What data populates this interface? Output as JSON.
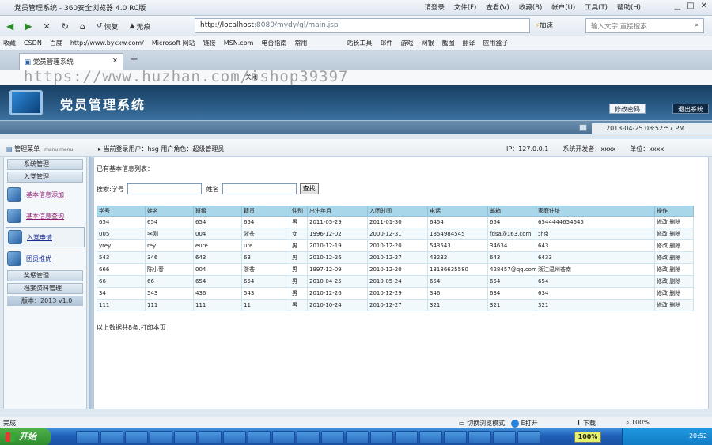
{
  "browser": {
    "window_title": "党员管理系统 - 360安全浏览器 4.0 RC版",
    "menus": [
      "请登录",
      "文件(F)",
      "查看(V)",
      "收藏(B)",
      "帐户(U)",
      "工具(T)",
      "帮助(H)"
    ],
    "nav": {
      "back": "后退",
      "forward": "前进",
      "restore": "恢复",
      "no_trace": "无痕"
    },
    "address_host": "http://localhost",
    "address_rest": ":8080/mydy/gl/main.jsp",
    "accelerate": "加速",
    "search_placeholder": "输入文字,直接搜索",
    "favorites": [
      "收藏",
      "CSDN",
      "百度",
      "http://www.bycxw.com/",
      "Microsoft 网站",
      "链接",
      "MSN.com",
      "电台指南",
      "常用",
      "站长工具",
      "邮件",
      "游戏",
      "网银",
      "截图",
      "翻译",
      "应用盒子"
    ],
    "tab_label": "党员管理系统",
    "tab_add": "+",
    "sub_text": "关闭",
    "watermark": "https://www.huzhan.com/ishop39397"
  },
  "app": {
    "title": "党员管理系统",
    "change_password": "修改密码",
    "logout": "退出系统",
    "datetime": "2013-04-25 08:52:57 PM"
  },
  "infobar": {
    "menu_title": "管理菜单",
    "menu_subtitle": "manu menu",
    "current_user": "当前登录用户：hsg  用户角色：超级管理员",
    "ip": "IP：127.0.0.1",
    "developer": "系统开发者：xxxx",
    "unit": "单位：xxxx"
  },
  "sidebar": {
    "sections": [
      "系统管理",
      "入党管理"
    ],
    "items": [
      "基本信息添加",
      "基本信息查询",
      "入党申请",
      "团员推优"
    ],
    "sections2": [
      "奖惩管理",
      "档案资料管理"
    ],
    "version": "版本：2013 v1.0"
  },
  "main": {
    "list_title": "已有基本信息列表：",
    "search_label_id": "搜索:学号",
    "search_label_name": "姓名",
    "search_button": "查找",
    "columns": [
      "学号",
      "姓名",
      "班级",
      "籍贯",
      "性别",
      "出生年月",
      "入团时间",
      "电话",
      "邮箱",
      "家庭住址",
      "操作"
    ],
    "rows": [
      [
        "654",
        "654",
        "654",
        "654",
        "男",
        "2011-05-29",
        "2011-01-30",
        "6454",
        "654",
        "6544444654645",
        "修改 删除"
      ],
      [
        "005",
        "李刚",
        "004",
        "浙苍",
        "女",
        "1996-12-02",
        "2000-12-31",
        "1354984545",
        "fdsa@163.com",
        "北京",
        "修改 删除"
      ],
      [
        "yrey",
        "rey",
        "eure",
        "ure",
        "男",
        "2010-12-19",
        "2010-12-20",
        "543543",
        "34634",
        "643",
        "修改 删除"
      ],
      [
        "543",
        "346",
        "643",
        "63",
        "男",
        "2010-12-26",
        "2010-12-27",
        "43232",
        "643",
        "6433",
        "修改 删除"
      ],
      [
        "666",
        "陈小春",
        "004",
        "浙苍",
        "男",
        "1997-12-09",
        "2010-12-20",
        "13186635580",
        "428457@qq.com",
        "浙江温州苍南",
        "修改 删除"
      ],
      [
        "66",
        "66",
        "654",
        "654",
        "男",
        "2010-04-25",
        "2010-05-24",
        "654",
        "654",
        "654",
        "修改 删除"
      ],
      [
        "34",
        "543",
        "436",
        "543",
        "男",
        "2010-12-26",
        "2010-12-29",
        "346",
        "634",
        "634",
        "修改 删除"
      ],
      [
        "111",
        "111",
        "111",
        "11",
        "男",
        "2010-10-24",
        "2010-12-27",
        "321",
        "321",
        "321",
        "修改 删除"
      ]
    ],
    "total_text": "以上数据共8条,打印本页"
  },
  "statusbar": {
    "left": "完成",
    "compat": "切换浏览模式",
    "zoom": "100%",
    "download": "下载",
    "fast": "E打开"
  },
  "taskbar": {
    "start": "开始",
    "percent": "100%",
    "clock": "20:52"
  }
}
